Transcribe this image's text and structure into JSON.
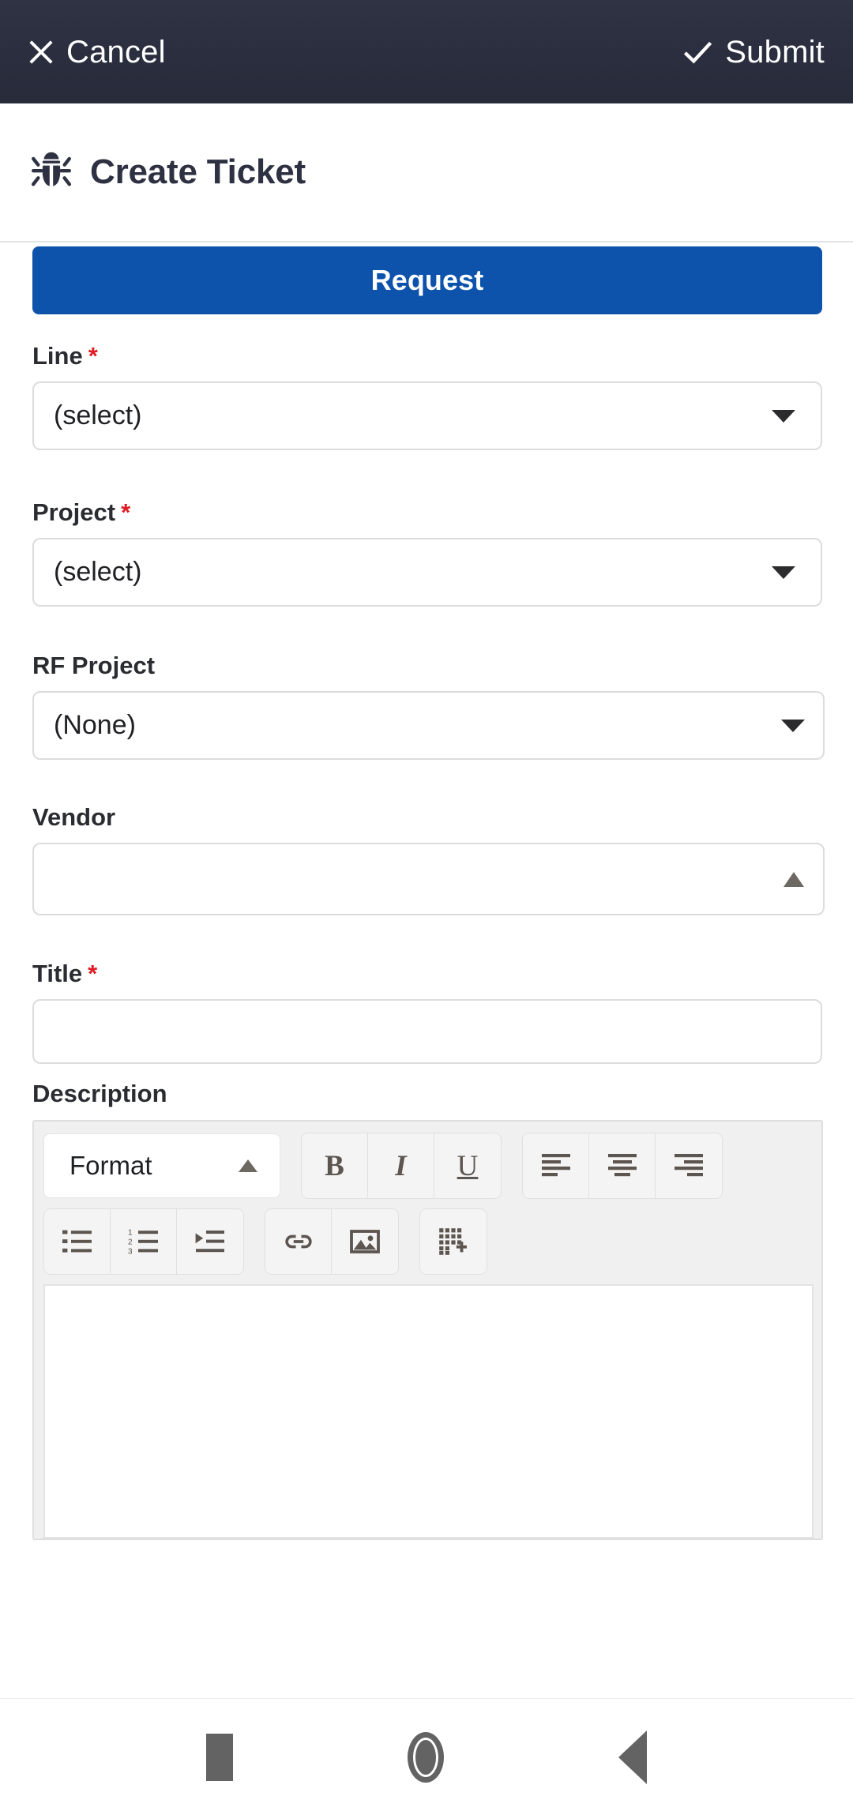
{
  "topbar": {
    "cancel_label": "Cancel",
    "cancel_icon": "close-icon",
    "submit_label": "Submit",
    "submit_icon": "check-icon",
    "background_color": "#2b2f40",
    "text_color": "#ffffff"
  },
  "header": {
    "icon": "bug-icon",
    "title": "Create Ticket",
    "title_color": "#2d3142"
  },
  "form": {
    "request_button": {
      "label": "Request",
      "color": "#0d52ab",
      "text_color": "#ffffff"
    },
    "required_marker": "*",
    "required_marker_color": "#e01b24",
    "fields": [
      {
        "name": "line",
        "label": "Line",
        "required": true,
        "type": "select",
        "value": "(select)",
        "icon": "chevron-down-icon"
      },
      {
        "name": "project",
        "label": "Project",
        "required": true,
        "type": "select",
        "value": "(select)",
        "icon": "chevron-down-icon"
      },
      {
        "name": "rf_project",
        "label": "RF Project",
        "required": false,
        "type": "select",
        "value": "(None)",
        "icon": "chevron-down-icon"
      },
      {
        "name": "vendor",
        "label": "Vendor",
        "required": false,
        "type": "autocomplete",
        "value": "",
        "placeholder": "",
        "icon": "chevron-up-icon"
      },
      {
        "name": "title",
        "label": "Title",
        "required": true,
        "type": "text",
        "value": "",
        "placeholder": ""
      },
      {
        "name": "description",
        "label": "Description",
        "required": false,
        "type": "richtext",
        "value": ""
      }
    ],
    "editor": {
      "format_label": "Format",
      "format_icon": "chevron-up-icon",
      "toolbar_row1": [
        {
          "name": "bold-button",
          "icon": "bold-icon",
          "glyph": "B"
        },
        {
          "name": "italic-button",
          "icon": "italic-icon",
          "glyph": "I"
        },
        {
          "name": "underline-button",
          "icon": "underline-icon",
          "glyph": "U"
        },
        {
          "name": "align-left-button",
          "icon": "align-left-icon"
        },
        {
          "name": "align-center-button",
          "icon": "align-center-icon"
        },
        {
          "name": "align-right-button",
          "icon": "align-right-icon"
        }
      ],
      "toolbar_row2": [
        {
          "name": "bullet-list-button",
          "icon": "bullet-list-icon"
        },
        {
          "name": "numbered-list-button",
          "icon": "numbered-list-icon"
        },
        {
          "name": "indent-button",
          "icon": "indent-icon"
        },
        {
          "name": "link-button",
          "icon": "link-icon"
        },
        {
          "name": "image-button",
          "icon": "image-icon"
        },
        {
          "name": "insert-table-button",
          "icon": "table-grid-plus-icon"
        }
      ],
      "content": ""
    }
  },
  "navbar": {
    "recents_label": "Recents",
    "home_label": "Home",
    "back_label": "Back",
    "icon_color": "#636363"
  }
}
